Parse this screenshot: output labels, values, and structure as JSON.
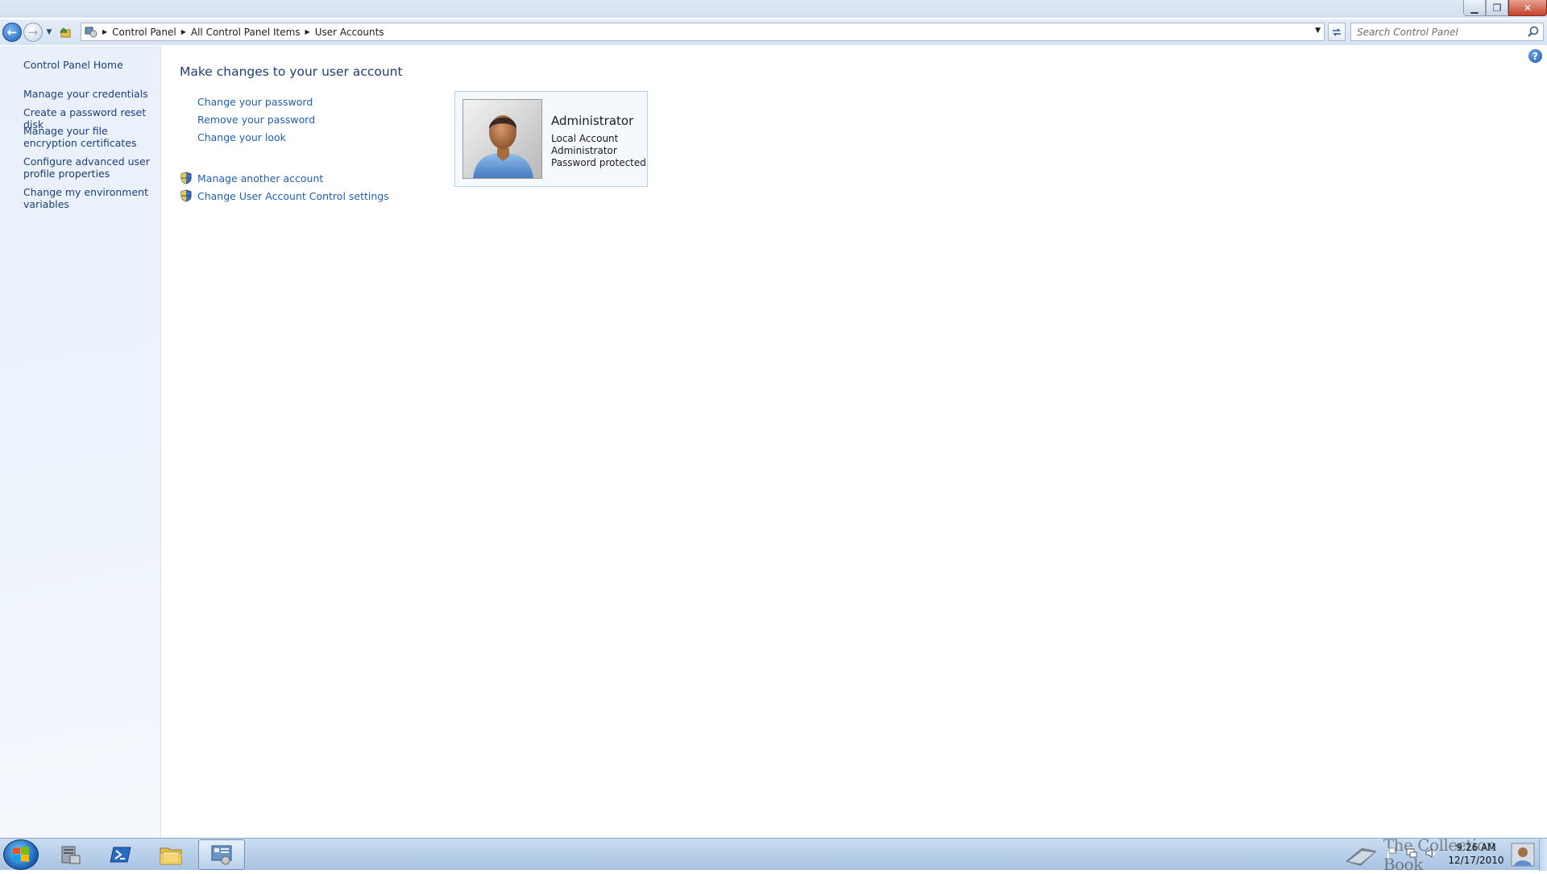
{
  "window": {
    "controls": {
      "minimize": "▁",
      "maximize": "❐",
      "close": "✕"
    }
  },
  "nav": {
    "back_icon": "back-arrow-icon",
    "forward_icon": "forward-arrow-icon",
    "breadcrumbs": [
      "Control Panel",
      "All Control Panel Items",
      "User Accounts"
    ],
    "search_placeholder": "Search Control Panel"
  },
  "sidebar": {
    "home": "Control Panel Home",
    "links": [
      "Manage your credentials",
      "Create a password reset disk",
      "Manage your file encryption certificates",
      "Configure advanced user profile properties",
      "Change my environment variables"
    ]
  },
  "main": {
    "title": "Make changes to your user account",
    "tasks": [
      "Change your password",
      "Remove your password",
      "Change your look"
    ],
    "admin_tasks": [
      "Manage another account",
      "Change User Account Control settings"
    ],
    "account": {
      "name": "Administrator",
      "type": "Local Account",
      "role": "Administrator",
      "status": "Password protected"
    }
  },
  "taskbar": {
    "apps": [
      "server-manager-icon",
      "powershell-icon",
      "windows-explorer-icon",
      "control-panel-icon"
    ],
    "watermark": "The Collection Book",
    "clock": {
      "time": "9:26 AM",
      "date": "12/17/2010"
    }
  },
  "colors": {
    "link": "#1f5fb2",
    "heading": "#1e3e7a",
    "sidebar_bg": "#eaf1fb",
    "taskbar": "#b9cfe9"
  }
}
